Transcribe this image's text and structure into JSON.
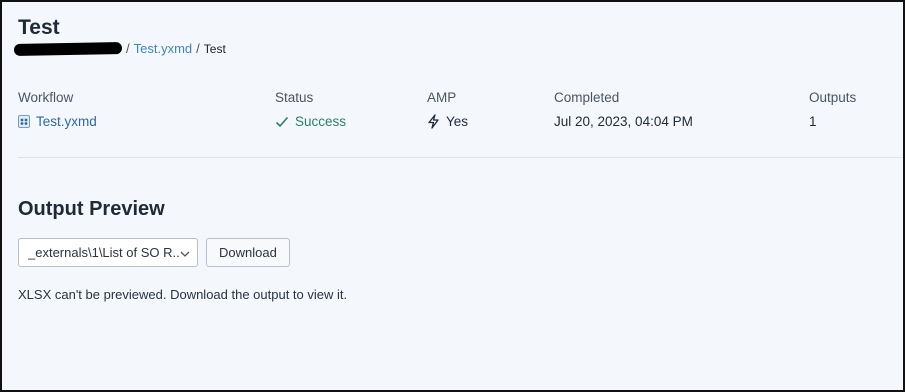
{
  "header": {
    "title": "Test",
    "breadcrumb": [
      {
        "label": "Test.yxmd"
      },
      {
        "label": "Test"
      }
    ],
    "separator": "/"
  },
  "meta": {
    "workflow": {
      "label": "Workflow",
      "value": "Test.yxmd",
      "icon": "workflow-file-icon"
    },
    "status": {
      "label": "Status",
      "value": "Success",
      "icon": "check-icon",
      "color": "#2b7f63"
    },
    "amp": {
      "label": "AMP",
      "value": "Yes",
      "icon": "lightning-icon"
    },
    "completed": {
      "label": "Completed",
      "value": "Jul 20, 2023, 04:04 PM"
    },
    "outputs": {
      "label": "Outputs",
      "value": "1"
    }
  },
  "output_preview": {
    "title": "Output Preview",
    "select_value": "_externals\\1\\List of SO R...",
    "download_label": "Download",
    "message": "XLSX can't be previewed. Download the output to view it."
  }
}
